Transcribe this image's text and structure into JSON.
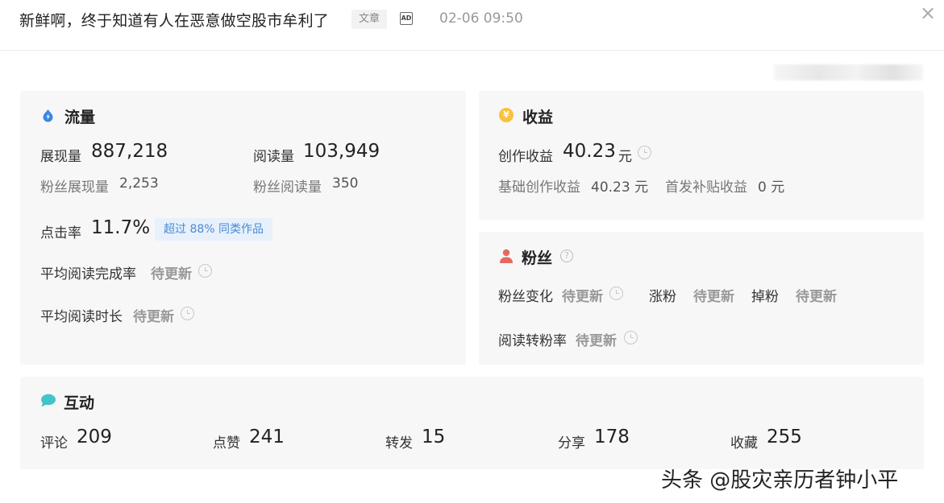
{
  "header": {
    "title": "新鲜啊，终于知道有人在恶意做空股市牟利了",
    "tag": "文章",
    "ad_icon": "AD",
    "time": "02-06 09:50",
    "close_icon": "×"
  },
  "traffic": {
    "title": "流量",
    "impressions_label": "展现量",
    "impressions": "887,218",
    "reads_label": "阅读量",
    "reads": "103,949",
    "fan_impressions_label": "粉丝展现量",
    "fan_impressions": "2,253",
    "fan_reads_label": "粉丝阅读量",
    "fan_reads": "350",
    "ctr_label": "点击率",
    "ctr": "11.7%",
    "ctr_badge": "超过 88% 同类作品",
    "completion_label": "平均阅读完成率",
    "completion": "待更新",
    "duration_label": "平均阅读时长",
    "duration": "待更新"
  },
  "earnings": {
    "title": "收益",
    "coin_icon": "¥",
    "creation_label": "创作收益",
    "creation": "40.23",
    "unit": "元",
    "base_label": "基础创作收益",
    "base": "40.23 元",
    "subsidy_label": "首发补贴收益",
    "subsidy": "0 元"
  },
  "fans": {
    "title": "粉丝",
    "help_icon": "?",
    "change_label": "粉丝变化",
    "change": "待更新",
    "gain_label": "涨粉",
    "gain": "待更新",
    "loss_label": "掉粉",
    "loss": "待更新",
    "conversion_label": "阅读转粉率",
    "conversion": "待更新"
  },
  "interaction": {
    "title": "互动",
    "comments_label": "评论",
    "comments": "209",
    "likes_label": "点赞",
    "likes": "241",
    "reposts_label": "转发",
    "reposts": "15",
    "shares_label": "分享",
    "shares": "178",
    "favorites_label": "收藏",
    "favorites": "255"
  },
  "watermark": "头条 @股灾亲历者钟小平",
  "colors": {
    "card_bg": "#f7f7f7",
    "drop_icon": "#3a86e0",
    "coin_icon": "#f7c142",
    "fan_icon": "#e56a5e",
    "chat_icon": "#43c4c9",
    "badge_bg": "#e8f1fb",
    "badge_text": "#4a8ad4",
    "pending_text": "#999999"
  }
}
